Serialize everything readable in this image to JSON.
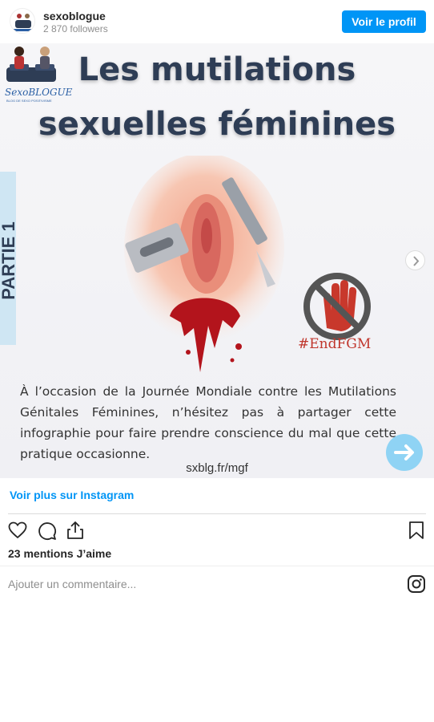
{
  "header": {
    "username": "sexoblogue",
    "followers": "2 870 followers",
    "profile_button": "Voir le profil"
  },
  "post": {
    "logo_text": "SexoBLOGUE",
    "logo_subtitle": "BLOG DE SEXO POSITIVISME",
    "title_line1": "Les mutilations",
    "title_line2": "sexuelles féminines",
    "side_tab": "PARTIE 1",
    "hashtag": "#EndFGM",
    "paragraph": "À l’occasion de la Journée Mondiale contre les Mutilations Génitales Féminines, n’hésitez pas à partager cette infographie pour faire prendre conscience du mal que cette pratique occasionne.",
    "url": "sxblg.fr/mgf"
  },
  "actions": {
    "more_link": "Voir plus sur Instagram",
    "likes": "23 mentions J’aime",
    "comment_placeholder": "Ajouter un commentaire..."
  },
  "icons": [
    "heart-icon",
    "comment-icon",
    "share-icon",
    "bookmark-icon",
    "instagram-icon",
    "chevron-right-icon",
    "arrow-right-icon"
  ],
  "colors": {
    "accent": "#0095f6",
    "title": "#2e3d55",
    "blood": "#b3141c",
    "tab": "#cfe6f3"
  }
}
